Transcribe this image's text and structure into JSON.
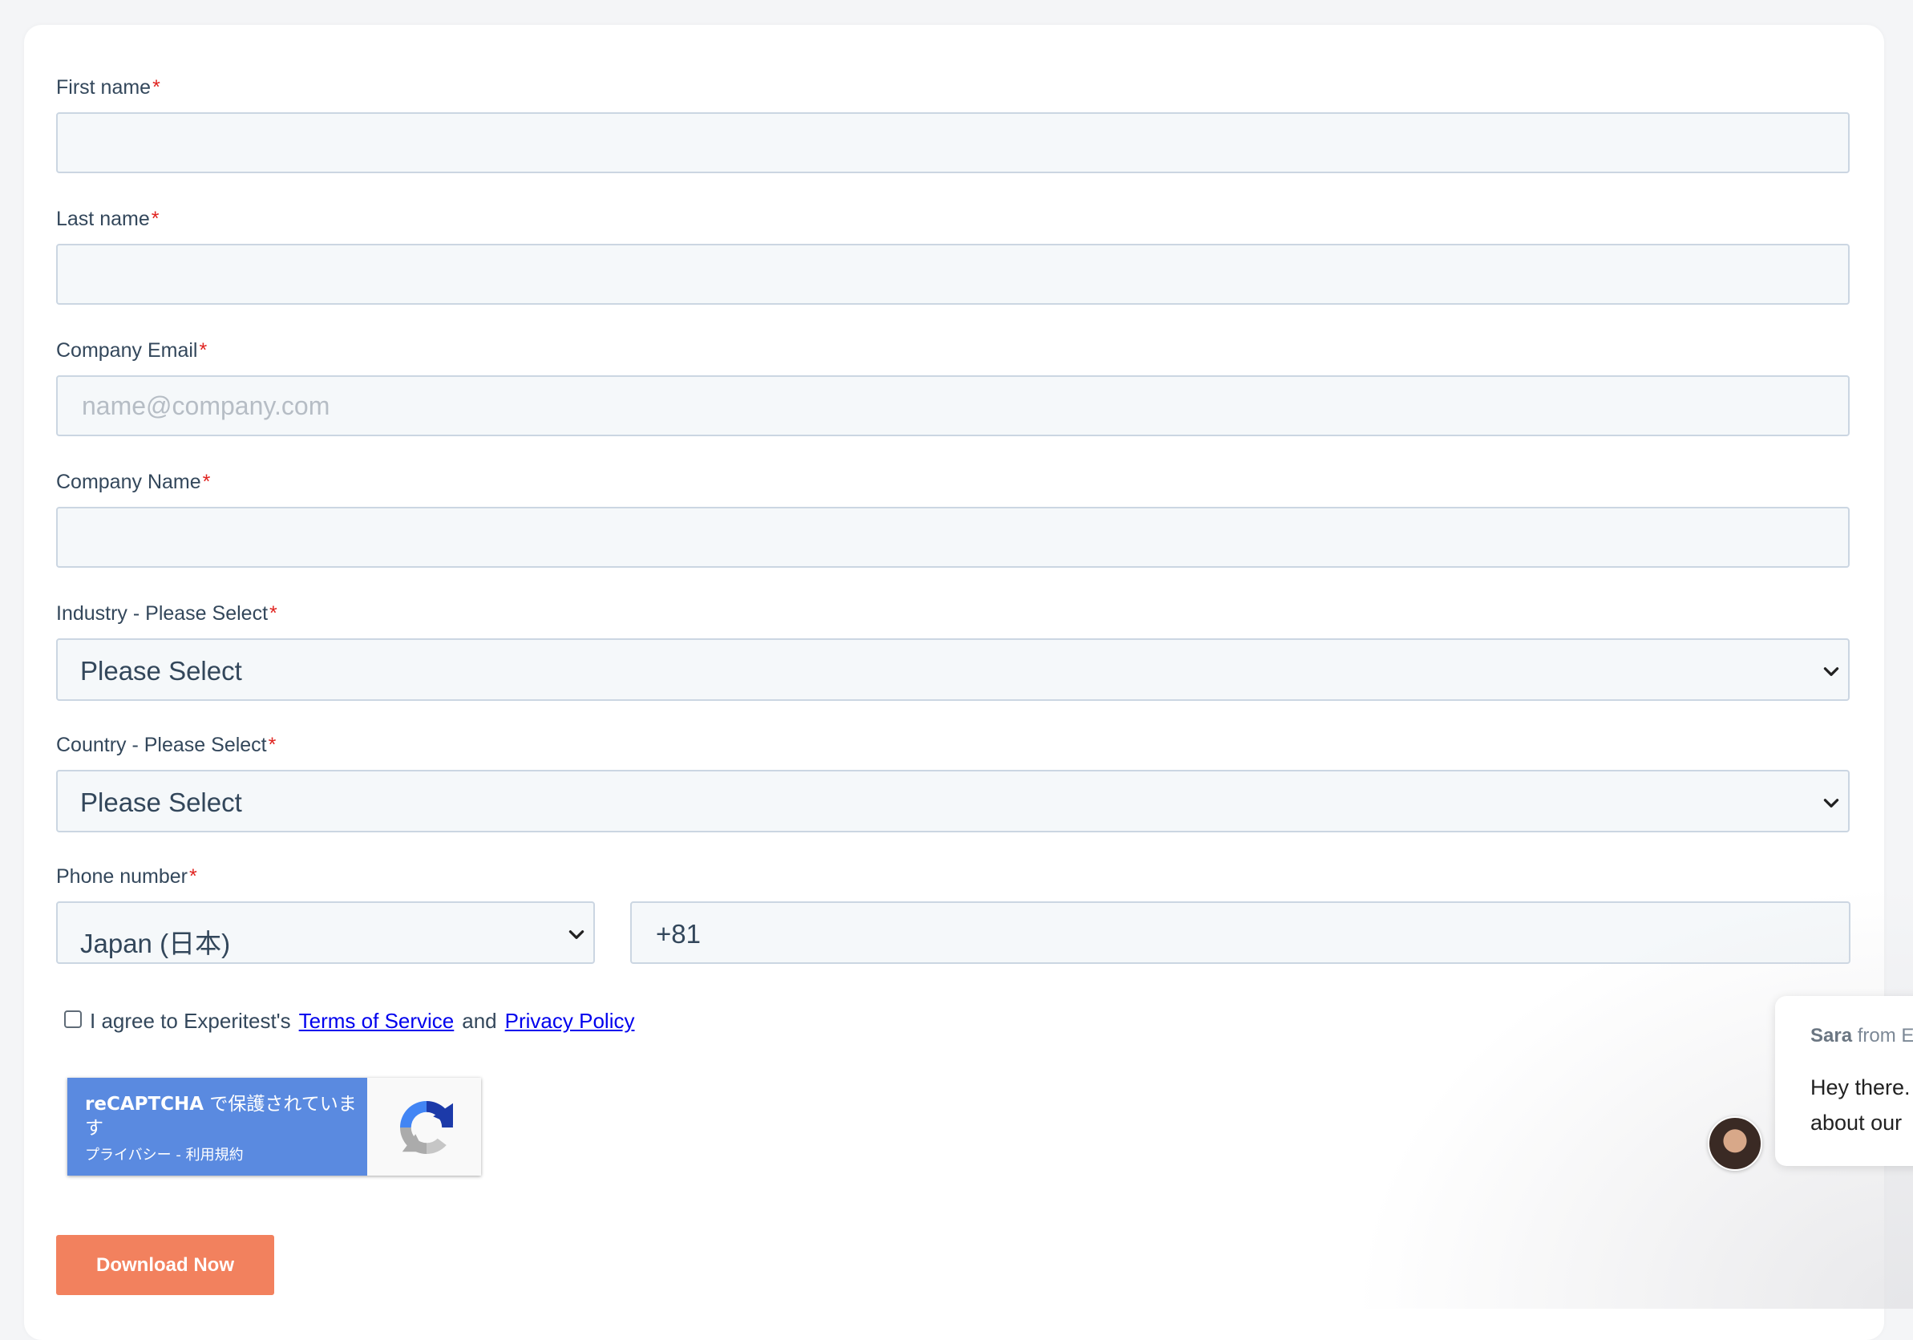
{
  "form": {
    "first_name": {
      "label": "First name",
      "required_mark": "*",
      "value": ""
    },
    "last_name": {
      "label": "Last name",
      "required_mark": "*",
      "value": ""
    },
    "company_email": {
      "label": "Company Email",
      "required_mark": "*",
      "value": "",
      "placeholder": "name@company.com"
    },
    "company_name": {
      "label": "Company Name",
      "required_mark": "*",
      "value": ""
    },
    "industry": {
      "label": "Industry - Please Select",
      "required_mark": "*",
      "selected": "Please Select"
    },
    "country": {
      "label": "Country - Please Select",
      "required_mark": "*",
      "selected": "Please Select"
    },
    "phone": {
      "label": "Phone number",
      "required_mark": "*",
      "country_selected": "Japan (日本)",
      "code": "+81"
    },
    "agree": {
      "prefix": "I agree to Experitest's",
      "terms": "Terms of Service",
      "and": "and",
      "privacy": "Privacy Policy"
    },
    "recaptcha": {
      "title_bold": "reCAPTCHA",
      "title_rest": " で保護されています",
      "links": "プライバシー - 利用規約"
    },
    "submit_label": "Download Now"
  },
  "chat": {
    "sender": "Sara",
    "sender_suffix": "from E",
    "line1": "Hey there.",
    "line2": "about our"
  },
  "colors": {
    "accent_button": "#f2815e",
    "input_bg": "#f5f8fa",
    "input_border": "#cbd6e2",
    "required": "#e0231f",
    "recaptcha_blue": "#5a8ae0"
  }
}
